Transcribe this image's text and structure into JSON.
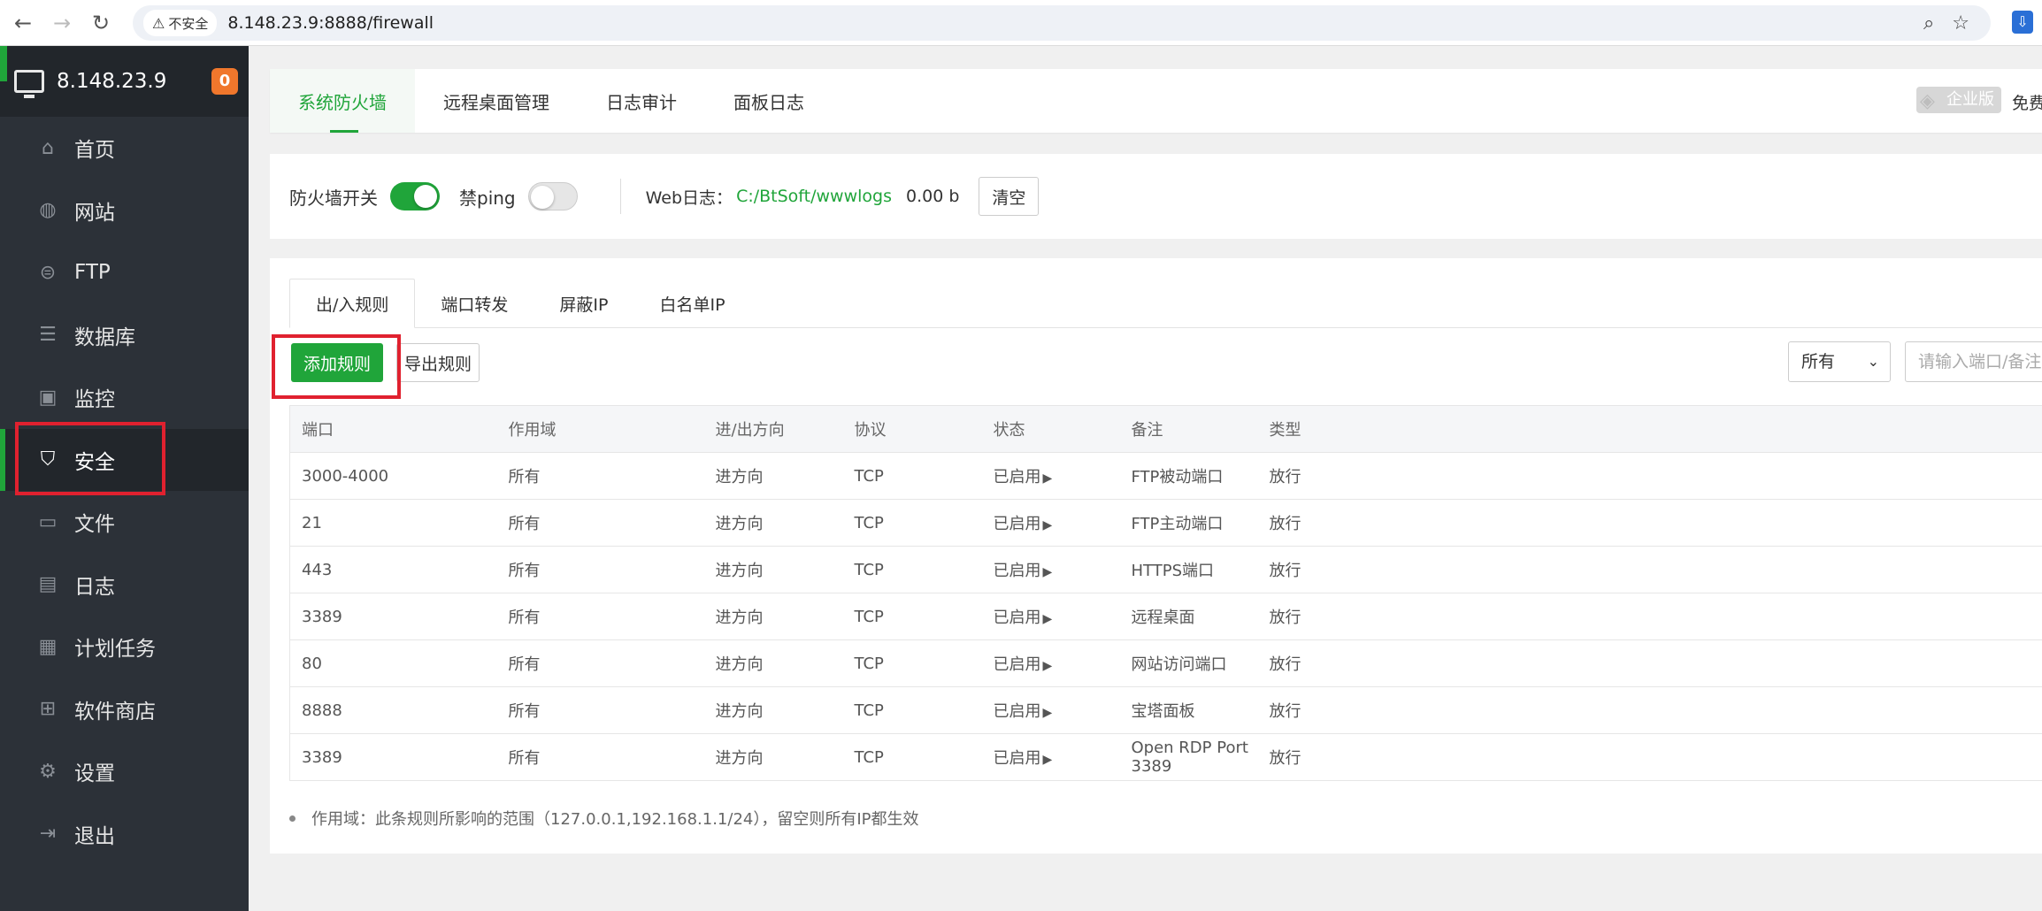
{
  "browser": {
    "insecure_label": "不安全",
    "url": "8.148.23.9:8888/firewall"
  },
  "sidebar": {
    "server_ip": "8.148.23.9",
    "badge_count": "0",
    "items": [
      {
        "label": "首页",
        "icon": "home-icon"
      },
      {
        "label": "网站",
        "icon": "globe-icon"
      },
      {
        "label": "FTP",
        "icon": "ftp-icon"
      },
      {
        "label": "数据库",
        "icon": "database-icon"
      },
      {
        "label": "监控",
        "icon": "monitor-chart-icon"
      },
      {
        "label": "安全",
        "icon": "shield-icon",
        "active": true
      },
      {
        "label": "文件",
        "icon": "folder-icon"
      },
      {
        "label": "日志",
        "icon": "log-icon"
      },
      {
        "label": "计划任务",
        "icon": "calendar-icon"
      },
      {
        "label": "软件商店",
        "icon": "apps-icon"
      },
      {
        "label": "设置",
        "icon": "gear-icon"
      },
      {
        "label": "退出",
        "icon": "logout-icon"
      }
    ]
  },
  "top_tabs": {
    "tab0": "系统防火墙",
    "tab1": "远程桌面管理",
    "tab2": "日志审计",
    "tab3": "面板日志",
    "enterprise": "企业版",
    "free": "免费"
  },
  "switches": {
    "firewall_label": "防火墙开关",
    "firewall_on": true,
    "ping_label": "禁ping",
    "ping_on": false,
    "weblog_label": "Web日志：",
    "weblog_path": "C:/BtSoft/wwwlogs",
    "weblog_size": "0.00 b",
    "clear_label": "清空"
  },
  "sub_tabs": {
    "tab0": "出/入规则",
    "tab1": "端口转发",
    "tab2": "屏蔽IP",
    "tab3": "白名单IP"
  },
  "toolbar": {
    "add_label": "添加规则",
    "export_label": "导出规则",
    "filter_value": "所有",
    "search_placeholder": "请输入端口/备注"
  },
  "table": {
    "headers": [
      "端口",
      "作用域",
      "进/出方向",
      "协议",
      "状态",
      "备注",
      "类型"
    ],
    "rows": [
      [
        "3000-4000",
        "所有",
        "进方向",
        "TCP",
        "已启用",
        "FTP被动端口",
        "放行"
      ],
      [
        "21",
        "所有",
        "进方向",
        "TCP",
        "已启用",
        "FTP主动端口",
        "放行"
      ],
      [
        "443",
        "所有",
        "进方向",
        "TCP",
        "已启用",
        "HTTPS端口",
        "放行"
      ],
      [
        "3389",
        "所有",
        "进方向",
        "TCP",
        "已启用",
        "远程桌面",
        "放行"
      ],
      [
        "80",
        "所有",
        "进方向",
        "TCP",
        "已启用",
        "网站访问端口",
        "放行"
      ],
      [
        "8888",
        "所有",
        "进方向",
        "TCP",
        "已启用",
        "宝塔面板",
        "放行"
      ],
      [
        "3389",
        "所有",
        "进方向",
        "TCP",
        "已启用",
        "Open RDP Port 3389",
        "放行"
      ]
    ]
  },
  "note": "作用域：此条规则所影响的范围（127.0.0.1,192.168.1.1/24），留空则所有IP都生效",
  "colors": {
    "accent": "#20a53a",
    "sidebar_bg": "#2c3138",
    "highlight_red": "#e0212f",
    "badge": "#f0772c"
  }
}
